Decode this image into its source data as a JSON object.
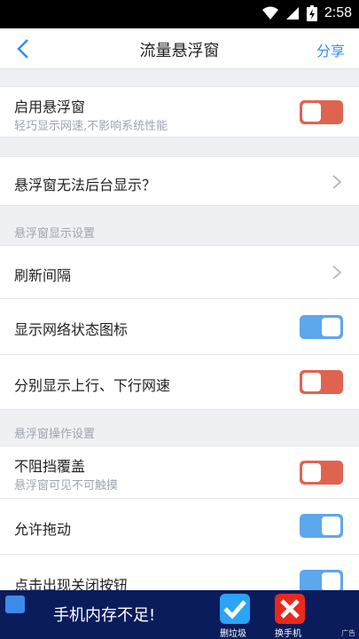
{
  "status_bar": {
    "time": "2:58"
  },
  "nav": {
    "title": "流量悬浮窗",
    "share_label": "分享"
  },
  "rows": {
    "enable": {
      "label": "启用悬浮窗",
      "subtitle": "轻巧显示网速,不影响系统性能",
      "toggle": "off"
    },
    "background": {
      "label": "悬浮窗无法后台显示？"
    },
    "section_display": "悬浮窗显示设置",
    "refresh": {
      "label": "刷新间隔"
    },
    "network_icon": {
      "label": "显示网络状态图标",
      "toggle": "on"
    },
    "split_speed": {
      "label": "分别显示上行、下行网速",
      "toggle": "off"
    },
    "section_operation": "悬浮窗操作设置",
    "no_block": {
      "label": "不阻挡覆盖",
      "subtitle": "悬浮窗可见不可触摸",
      "toggle": "off"
    },
    "drag": {
      "label": "允许拖动",
      "toggle": "on"
    },
    "close_button": {
      "label": "点击出现关闭按钮",
      "toggle": "on"
    }
  },
  "ad": {
    "text": "手机内存不足!",
    "btn1_label": "删垃圾",
    "btn2_label": "换手机",
    "ad_mark": "广告"
  },
  "colors": {
    "accent": "#2f8ff3",
    "toggle_on": "#5da7ec",
    "toggle_off": "#df6450",
    "ad_bg": "#0b1c5c"
  }
}
